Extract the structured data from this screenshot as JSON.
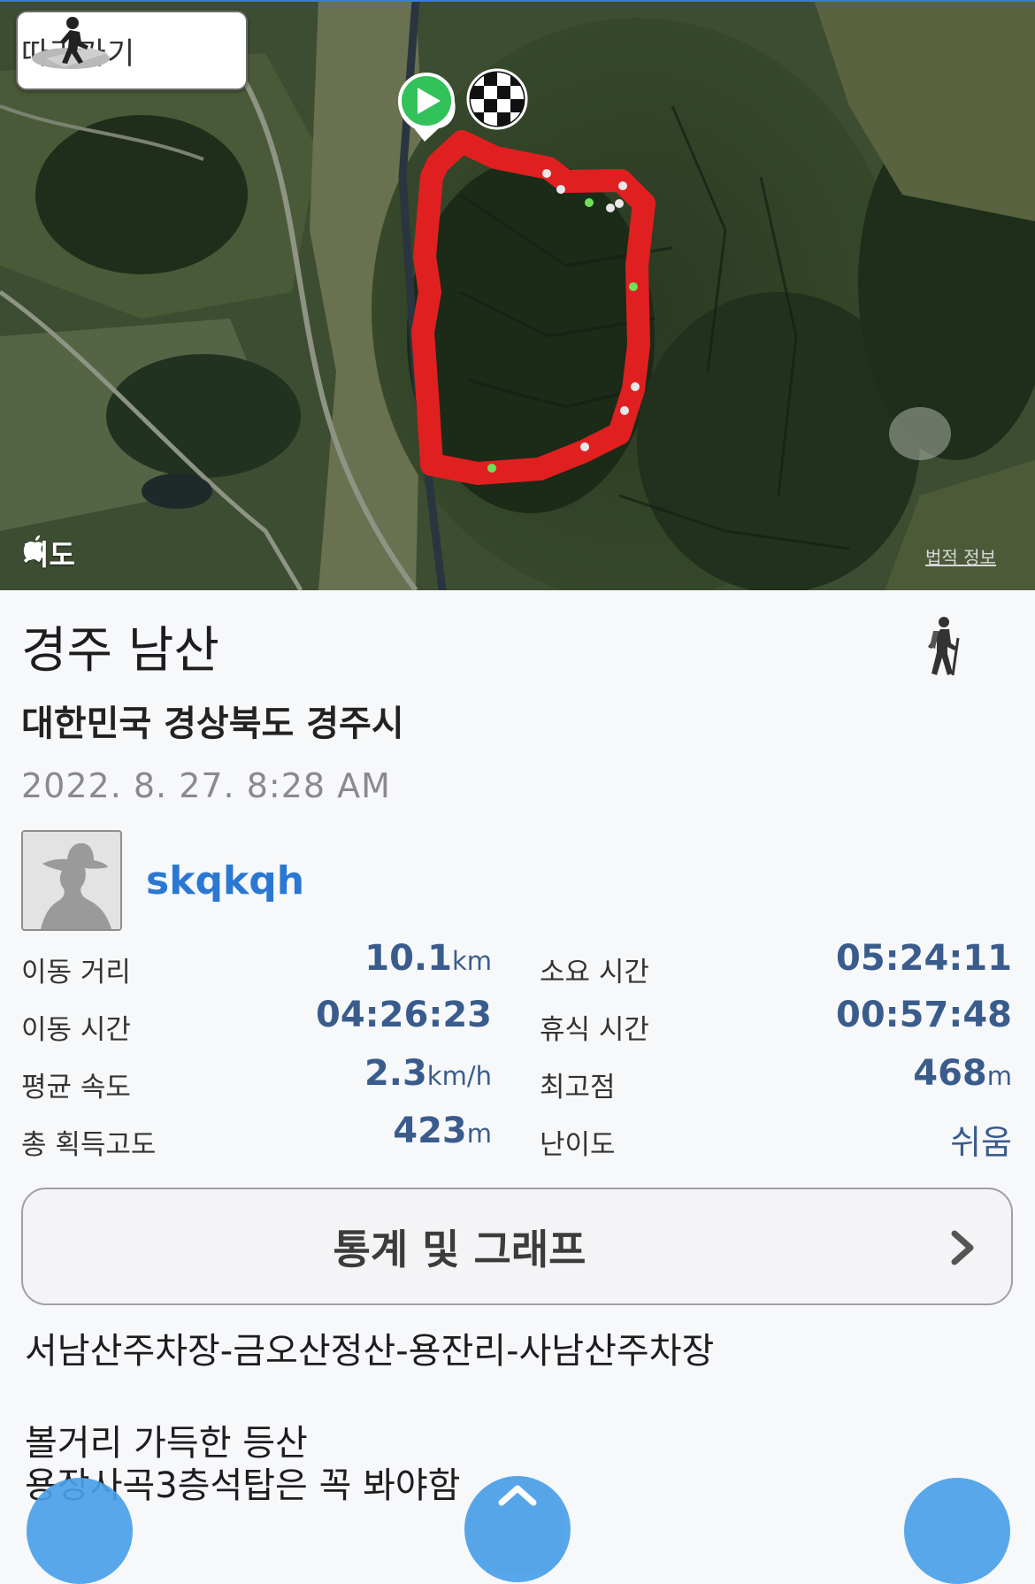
{
  "map": {
    "follow_label": "따라가기",
    "maps_logo": "지도",
    "legal_link": "법적 정보",
    "route_color": "#e02020",
    "start_marker_color": "#33c15a"
  },
  "track": {
    "title": "경주 남산",
    "activity_icon": "hiking-icon",
    "location": "대한민국 경상북도 경주시",
    "datetime": "2022. 8. 27. 8:28 AM",
    "username": "skqkqh"
  },
  "stats": {
    "distance": {
      "label": "이동 거리",
      "value": "10.1",
      "unit": "km"
    },
    "total_time": {
      "label": "소요 시간",
      "value": "05:24:11"
    },
    "moving_time": {
      "label": "이동 시간",
      "value": "04:26:23"
    },
    "rest_time": {
      "label": "휴식 시간",
      "value": "00:57:48"
    },
    "avg_speed": {
      "label": "평균 속도",
      "value": "2.3",
      "unit": "km/h"
    },
    "max_elevation": {
      "label": "최고점",
      "value": "468",
      "unit": "m"
    },
    "total_ascent": {
      "label": "총 획득고도",
      "value": "423",
      "unit": "m"
    },
    "difficulty": {
      "label": "난이도",
      "value": "쉬움"
    }
  },
  "stats_button": {
    "label": "통계 및 그래프"
  },
  "route_name": "서남산주차장-금오산정산-용잔리-사남산주차장",
  "description": {
    "line1": "볼거리 가득한 등산",
    "line2": "용장사곡3층석탑은 꼭 봐야함"
  },
  "colors": {
    "value_blue": "#3a5c8c",
    "link_blue": "#2b78d3",
    "float_button": "#4a9fe8"
  }
}
